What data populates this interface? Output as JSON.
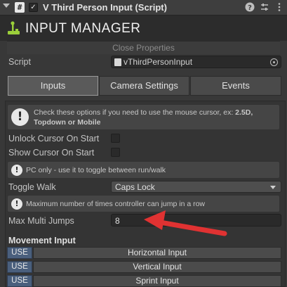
{
  "header": {
    "title": "V Third Person Input (Script)",
    "script_icon": "#",
    "enabled_mark": "✓",
    "icons": [
      "help-icon",
      "presets-icon",
      "more-icon"
    ]
  },
  "logo": {
    "text": "INPUT MANAGER"
  },
  "close_properties": "Close Properties",
  "script_field": {
    "label": "Script",
    "value": "vThirdPersonInput"
  },
  "tabs": [
    {
      "label": "Inputs",
      "active": true
    },
    {
      "label": "Camera Settings",
      "active": false
    },
    {
      "label": "Events",
      "active": false
    }
  ],
  "help_boxes": {
    "cursor_line1": "Check these options if you need to use the mouse cursor, ex: ",
    "cursor_bold1": "2.5D,",
    "cursor_bold2": "Topdown or Mobile",
    "walk": "PC only - use it to toggle between run/walk",
    "jumps": "Maximum number of times controller can jump in a row"
  },
  "fields": {
    "unlock_cursor": {
      "label": "Unlock Cursor On Start",
      "checked": false
    },
    "show_cursor": {
      "label": "Show Cursor On Start",
      "checked": false
    },
    "toggle_walk": {
      "label": "Toggle Walk",
      "value": "Caps Lock"
    },
    "max_jumps": {
      "label": "Max Multi Jumps",
      "value": "8"
    }
  },
  "movement_input": {
    "title": "Movement Input",
    "rows": [
      {
        "use": "USE",
        "name": "Horizontal Input"
      },
      {
        "use": "USE",
        "name": "Vertical Input"
      },
      {
        "use": "USE",
        "name": "Sprint Input"
      }
    ]
  },
  "colors": {
    "accent_use": "#4a5f7d",
    "annotation_arrow": "#e03232",
    "logo_green": "#9bcf3a"
  }
}
